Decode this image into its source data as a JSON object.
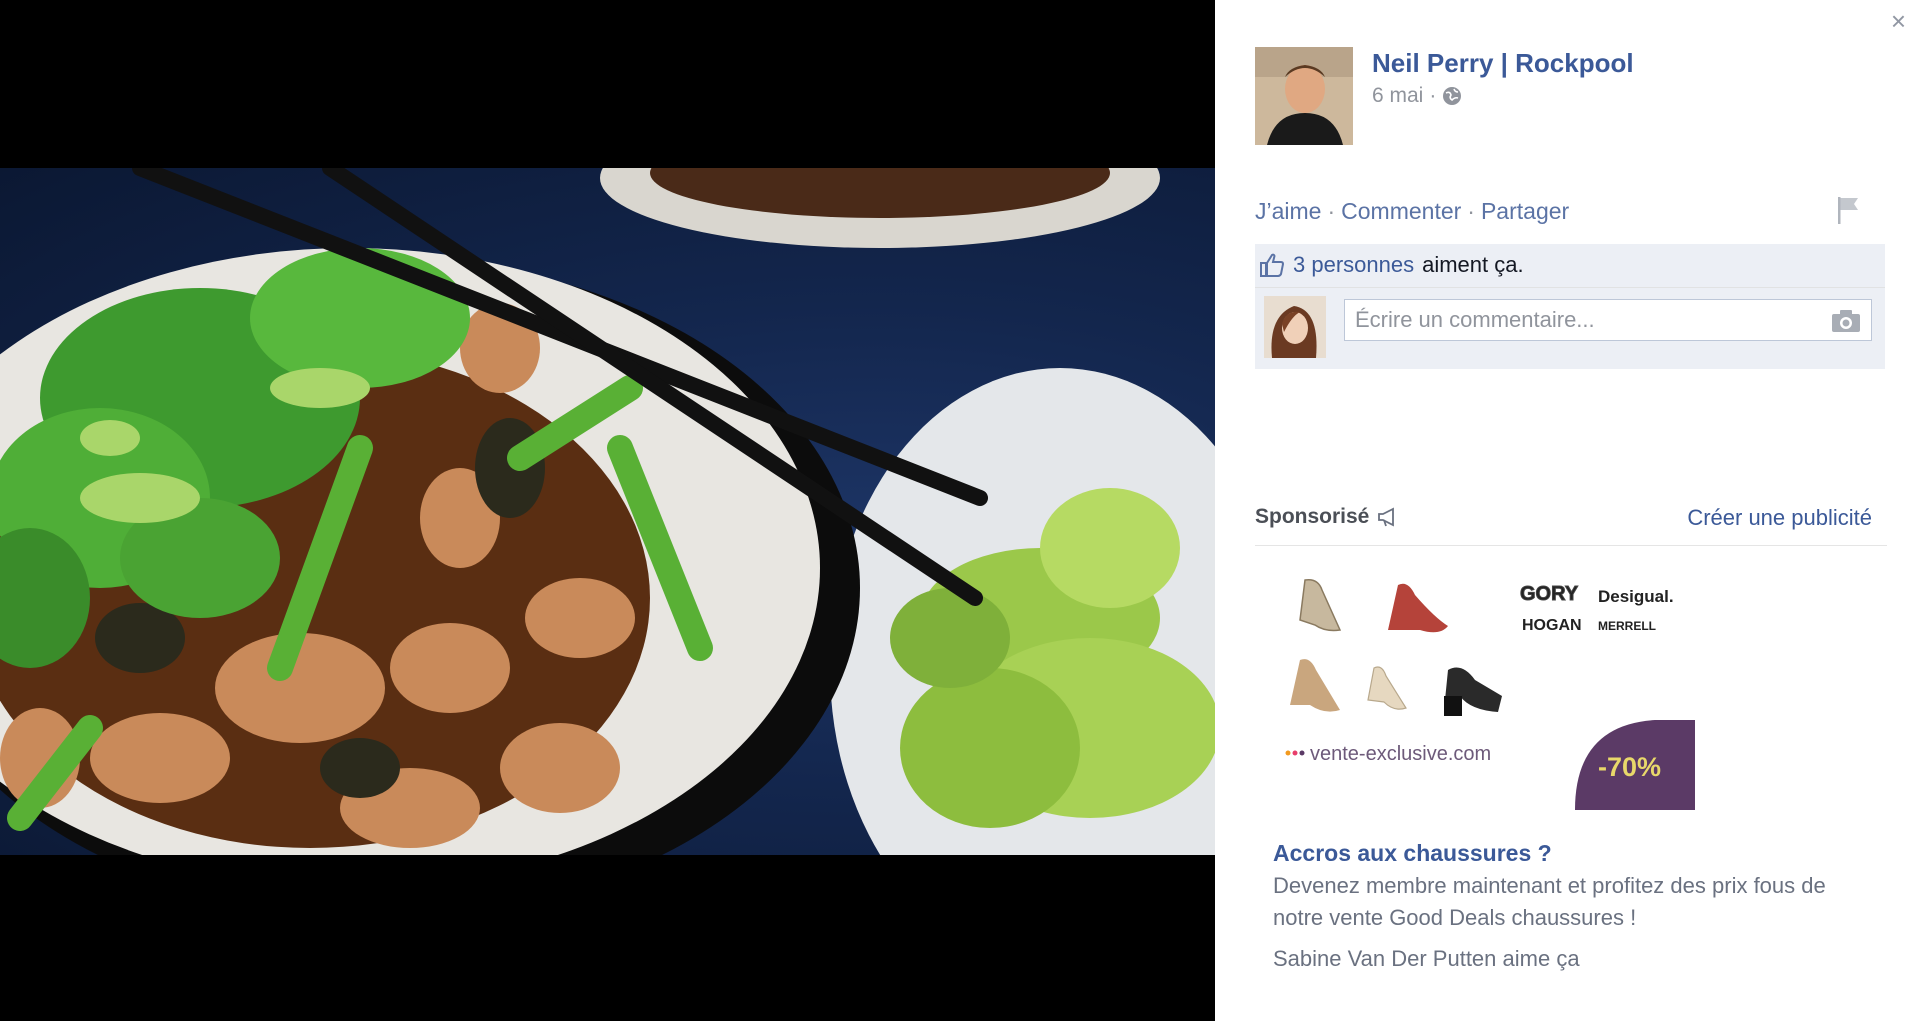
{
  "post": {
    "author": "Neil Perry | Rockpool",
    "date": "6 mai",
    "date_sep": "·",
    "privacy_icon": "globe-icon"
  },
  "actions": {
    "like": "J’aime",
    "comment": "Commenter",
    "share": "Partager",
    "sep": "·"
  },
  "likes": {
    "count_text": "3 personnes",
    "suffix_text": "aiment ça."
  },
  "comment": {
    "placeholder": "Écrire un commentaire..."
  },
  "sponsored": {
    "label": "Sponsorisé",
    "create_ad": "Créer une publicité"
  },
  "ad": {
    "brands": [
      "GORY",
      "Desigual.",
      "HOGAN",
      "MERRELL"
    ],
    "site": "vente-exclusive.com",
    "discount": "-70%",
    "title": "Accros aux chaussures ?",
    "description": "Devenez membre maintenant et profitez des prix fous de notre vente Good Deals chaussures !",
    "social": "Sabine Van Der Putten aime ça"
  },
  "close_label": "×",
  "colors": {
    "link_blue": "#3b5998",
    "muted": "#90949c",
    "likes_bg": "#eceff5",
    "ad_purple": "#5b3a66"
  }
}
